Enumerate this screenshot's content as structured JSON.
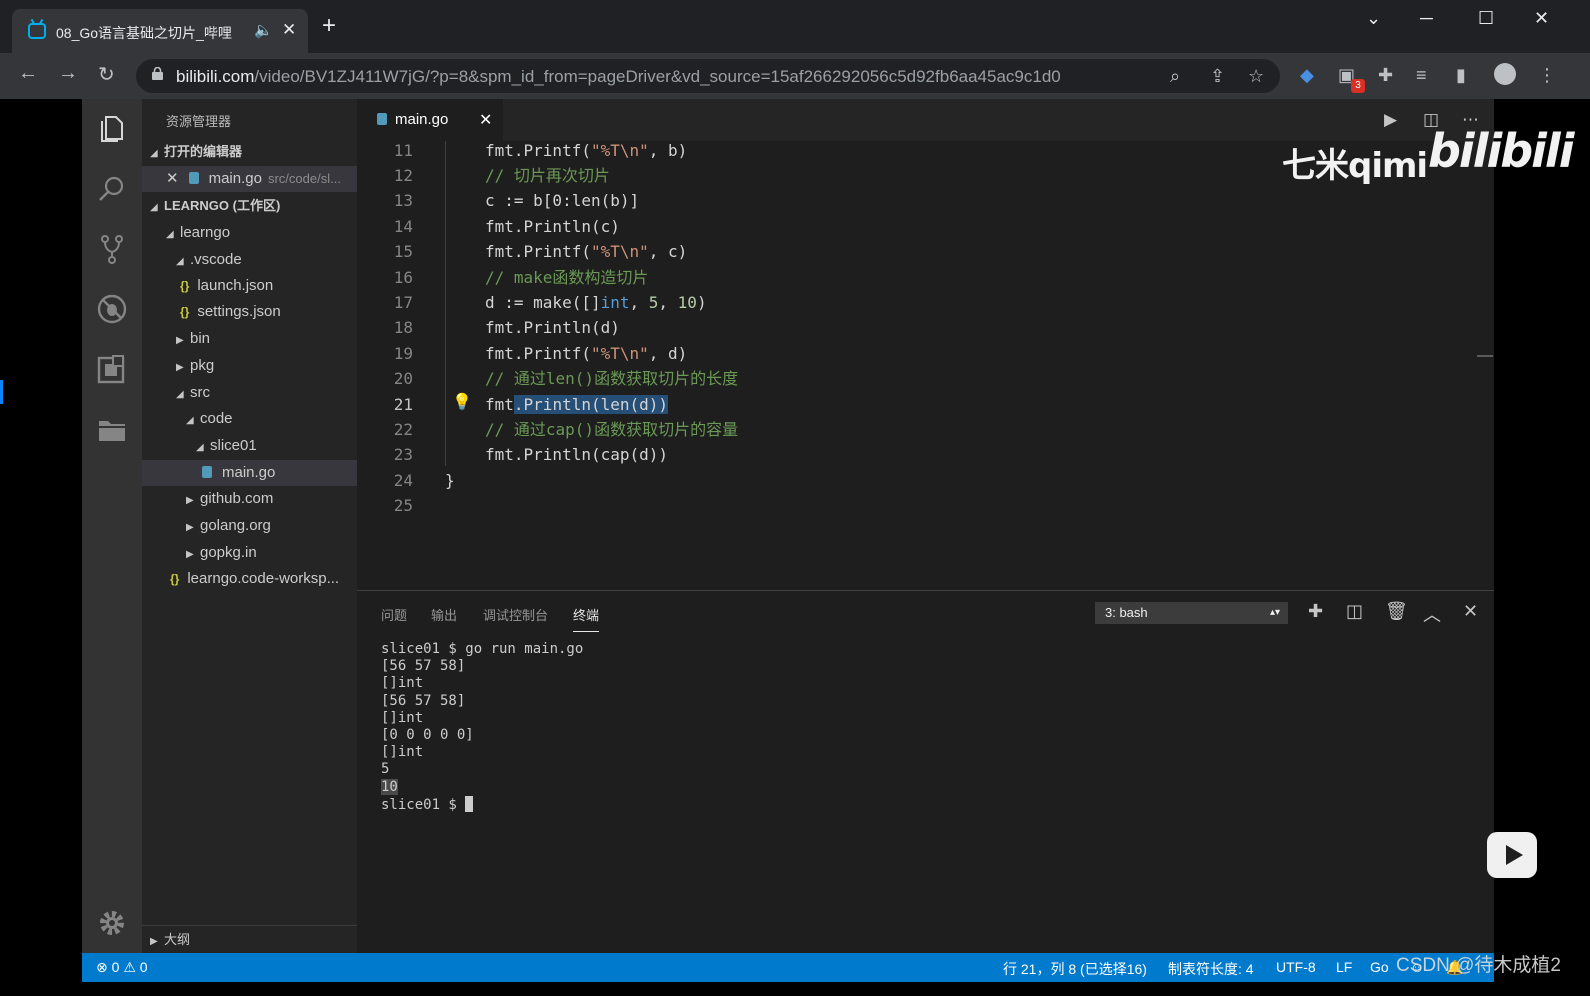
{
  "browser": {
    "tab_title": "08_Go语言基础之切片_哔哩",
    "tab_audio_icon": "speaker-icon",
    "url_domain": "bilibili.com",
    "url_rest": "/video/BV1ZJ411W7jG/?p=8&spm_id_from=pageDriver&vd_source=15af266292056c5d92fb6aa45ac9c1d0",
    "extension_badge": "3"
  },
  "sidebar": {
    "header": "资源管理器",
    "open_editors_label": "打开的编辑器",
    "open_editor": {
      "name": "main.go",
      "path": "src/code/sl..."
    },
    "workspace_label": "LEARNGO (工作区)",
    "tree": [
      {
        "label": "learngo"
      },
      {
        "label": ".vscode"
      },
      {
        "label": "launch.json"
      },
      {
        "label": "settings.json"
      },
      {
        "label": "bin"
      },
      {
        "label": "pkg"
      },
      {
        "label": "src"
      },
      {
        "label": "code"
      },
      {
        "label": "slice01"
      },
      {
        "label": "main.go"
      },
      {
        "label": "github.com"
      },
      {
        "label": "golang.org"
      },
      {
        "label": "gopkg.in"
      },
      {
        "label": "learngo.code-worksp..."
      }
    ],
    "outline_label": "大纲"
  },
  "editor": {
    "tab_name": "main.go",
    "line_numbers": [
      "11",
      "12",
      "13",
      "14",
      "15",
      "16",
      "17",
      "18",
      "19",
      "20",
      "21",
      "22",
      "23",
      "24",
      "25"
    ],
    "lines": {
      "l11a": "fmt.Printf(",
      "l11s": "\"%T\\n\"",
      "l11b": ", b)",
      "l12": "// 切片再次切片",
      "l13": "c := b[0:len(b)]",
      "l14": "fmt.Println(c)",
      "l15a": "fmt.Printf(",
      "l15s": "\"%T\\n\"",
      "l15b": ", c)",
      "l16": "// make函数构造切片",
      "l17a": "d := make([]",
      "l17k": "int",
      "l17b": ", ",
      "l17n1": "5",
      "l17c": ", ",
      "l17n2": "10",
      "l17d": ")",
      "l18": "fmt.Println(d)",
      "l19a": "fmt.Printf(",
      "l19s": "\"%T\\n\"",
      "l19b": ", d)",
      "l20": "// 通过len()函数获取切片的长度",
      "l21a": "fmt",
      "l21sel": ".Println(len(d))",
      "l22": "// 通过cap()函数获取切片的容量",
      "l23": "fmt.Println(cap(d))",
      "l24": "}"
    }
  },
  "panel": {
    "tabs": [
      "问题",
      "输出",
      "调试控制台",
      "终端"
    ],
    "active_tab": "终端",
    "terminal_select": "3: bash",
    "terminal_lines": [
      "slice01 $ go run main.go",
      "[56 57 58]",
      "[]int",
      "[56 57 58]",
      "[]int",
      "[0 0 0 0 0]",
      "[]int",
      "5",
      "10"
    ],
    "prompt": "slice01 $ "
  },
  "statusbar": {
    "errors": "0",
    "warnings": "0",
    "position": "行 21，列 8 (已选择16)",
    "tab_size": "制表符长度: 4",
    "encoding": "UTF-8",
    "eol": "LF",
    "language": "Go"
  },
  "overlays": {
    "watermark_left": "七米qimi",
    "watermark_right": "bilibili",
    "csdn": "CSDN @待木成植2"
  },
  "colors": {
    "statusbar": "#007acc",
    "comment": "#6a9955",
    "string": "#ce9178",
    "number": "#b5cea8",
    "keyword": "#569cd6"
  }
}
